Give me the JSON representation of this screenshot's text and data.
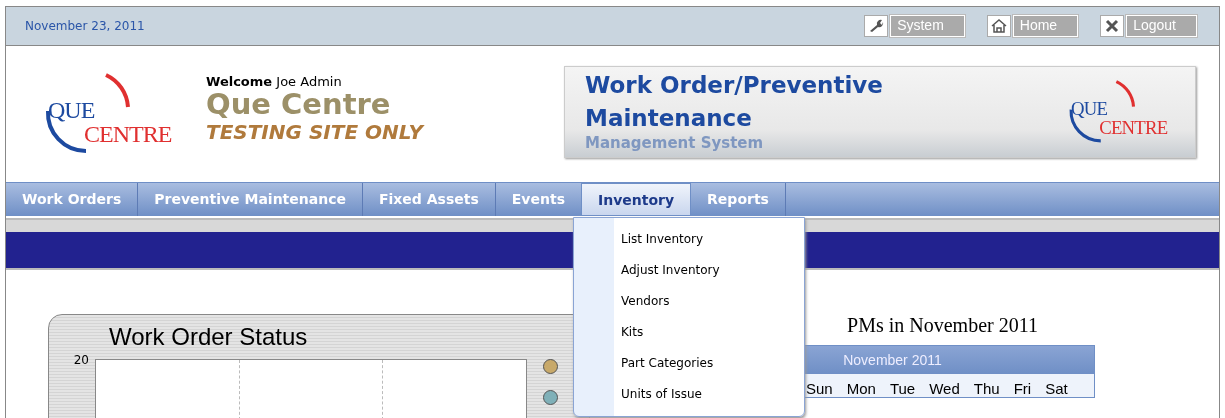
{
  "top_bar": {
    "date": "November 23, 2011",
    "buttons": [
      {
        "kind": "wrench",
        "label": "System"
      },
      {
        "kind": "house",
        "label": "Home"
      },
      {
        "kind": "x",
        "label": "Logout"
      }
    ]
  },
  "header": {
    "logo": {
      "line_1": "QUE",
      "line_2": "CENTRE"
    },
    "welcome_label": "Welcome",
    "user": "Joe Admin",
    "site_name": "Que Centre",
    "site_note": "TESTING SITE ONLY",
    "banner": {
      "title": "Work Order/Preventive Maintenance",
      "subtitle": "Management System",
      "logo": {
        "line_1": "QUE",
        "line_2": "CENTRE"
      }
    }
  },
  "nav": [
    {
      "label": "Work Orders",
      "selected": false
    },
    {
      "label": "Preventive Maintenance",
      "selected": false
    },
    {
      "label": "Fixed Assets",
      "selected": false
    },
    {
      "label": "Events",
      "selected": false
    },
    {
      "label": "Inventory",
      "selected": true
    },
    {
      "label": "Reports",
      "selected": false
    }
  ],
  "dropdown": [
    "List Inventory",
    "Adjust Inventory",
    "Vendors",
    "Kits",
    "Part Categories",
    "Units of Issue"
  ],
  "chart_panel": {
    "title": "Work Order Status",
    "y_tick": "20",
    "legend": [
      {
        "color": "#c8a96a"
      },
      {
        "color": "#7fb0b8"
      }
    ]
  },
  "calendar": {
    "heading": "PMs in November 2011",
    "month": "November 2011",
    "days": [
      "Sun",
      "Mon",
      "Tue",
      "Wed",
      "Thu",
      "Fri",
      "Sat"
    ]
  }
}
